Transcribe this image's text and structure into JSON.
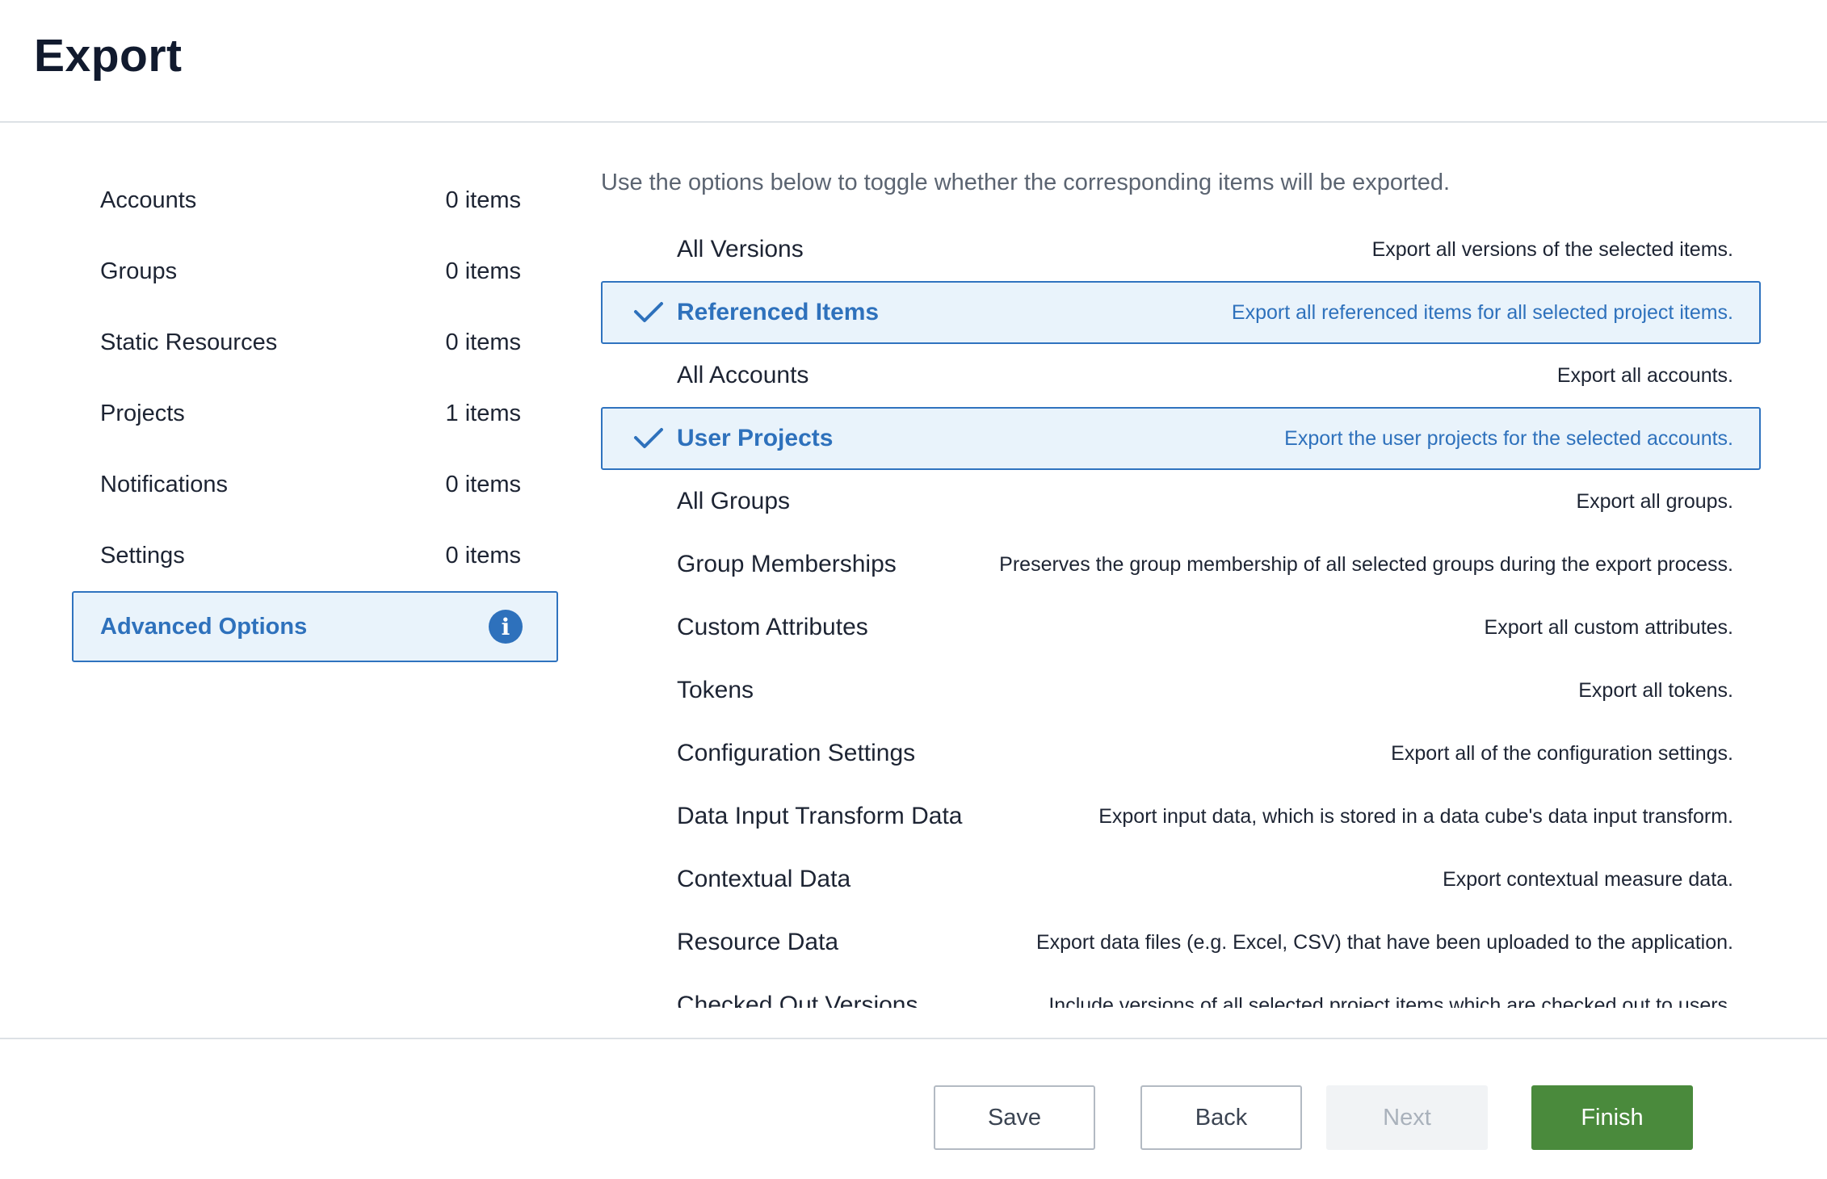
{
  "header": {
    "title": "Export"
  },
  "sidebar": {
    "items": [
      {
        "label": "Accounts",
        "count": "0 items"
      },
      {
        "label": "Groups",
        "count": "0 items"
      },
      {
        "label": "Static Resources",
        "count": "0 items"
      },
      {
        "label": "Projects",
        "count": "1 items"
      },
      {
        "label": "Notifications",
        "count": "0 items"
      },
      {
        "label": "Settings",
        "count": "0 items"
      }
    ],
    "advanced": {
      "label": "Advanced Options",
      "icon": "info-icon",
      "selected": true
    }
  },
  "main": {
    "instructions": "Use the options below to toggle whether the corresponding items will be exported.",
    "options": [
      {
        "label": "All Versions",
        "desc": "Export all versions of the selected items.",
        "checked": false
      },
      {
        "label": "Referenced Items",
        "desc": "Export all referenced items for all selected project items.",
        "checked": true
      },
      {
        "label": "All Accounts",
        "desc": "Export all accounts.",
        "checked": false
      },
      {
        "label": "User Projects",
        "desc": "Export the user projects for the selected accounts.",
        "checked": true
      },
      {
        "label": "All Groups",
        "desc": "Export all groups.",
        "checked": false
      },
      {
        "label": "Group Memberships",
        "desc": "Preserves the group membership of all selected groups during the export process.",
        "checked": false
      },
      {
        "label": "Custom Attributes",
        "desc": "Export all custom attributes.",
        "checked": false
      },
      {
        "label": "Tokens",
        "desc": "Export all tokens.",
        "checked": false
      },
      {
        "label": "Configuration Settings",
        "desc": "Export all of the configuration settings.",
        "checked": false
      },
      {
        "label": "Data Input Transform Data",
        "desc": "Export input data, which is stored in a data cube's data input transform.",
        "checked": false
      },
      {
        "label": "Contextual Data",
        "desc": "Export contextual measure data.",
        "checked": false
      },
      {
        "label": "Resource Data",
        "desc": "Export data files (e.g. Excel, CSV) that have been uploaded to the application.",
        "checked": false
      },
      {
        "label": "Checked Out Versions",
        "desc": "Include versions of all selected project items which are checked out to users.",
        "checked": false
      }
    ]
  },
  "footer": {
    "save_label": "Save",
    "back_label": "Back",
    "next_label": "Next",
    "finish_label": "Finish",
    "colors": {
      "accent": "#2e71bc",
      "finish": "#4a8a3c",
      "selected_bg": "#e9f3fb"
    }
  }
}
